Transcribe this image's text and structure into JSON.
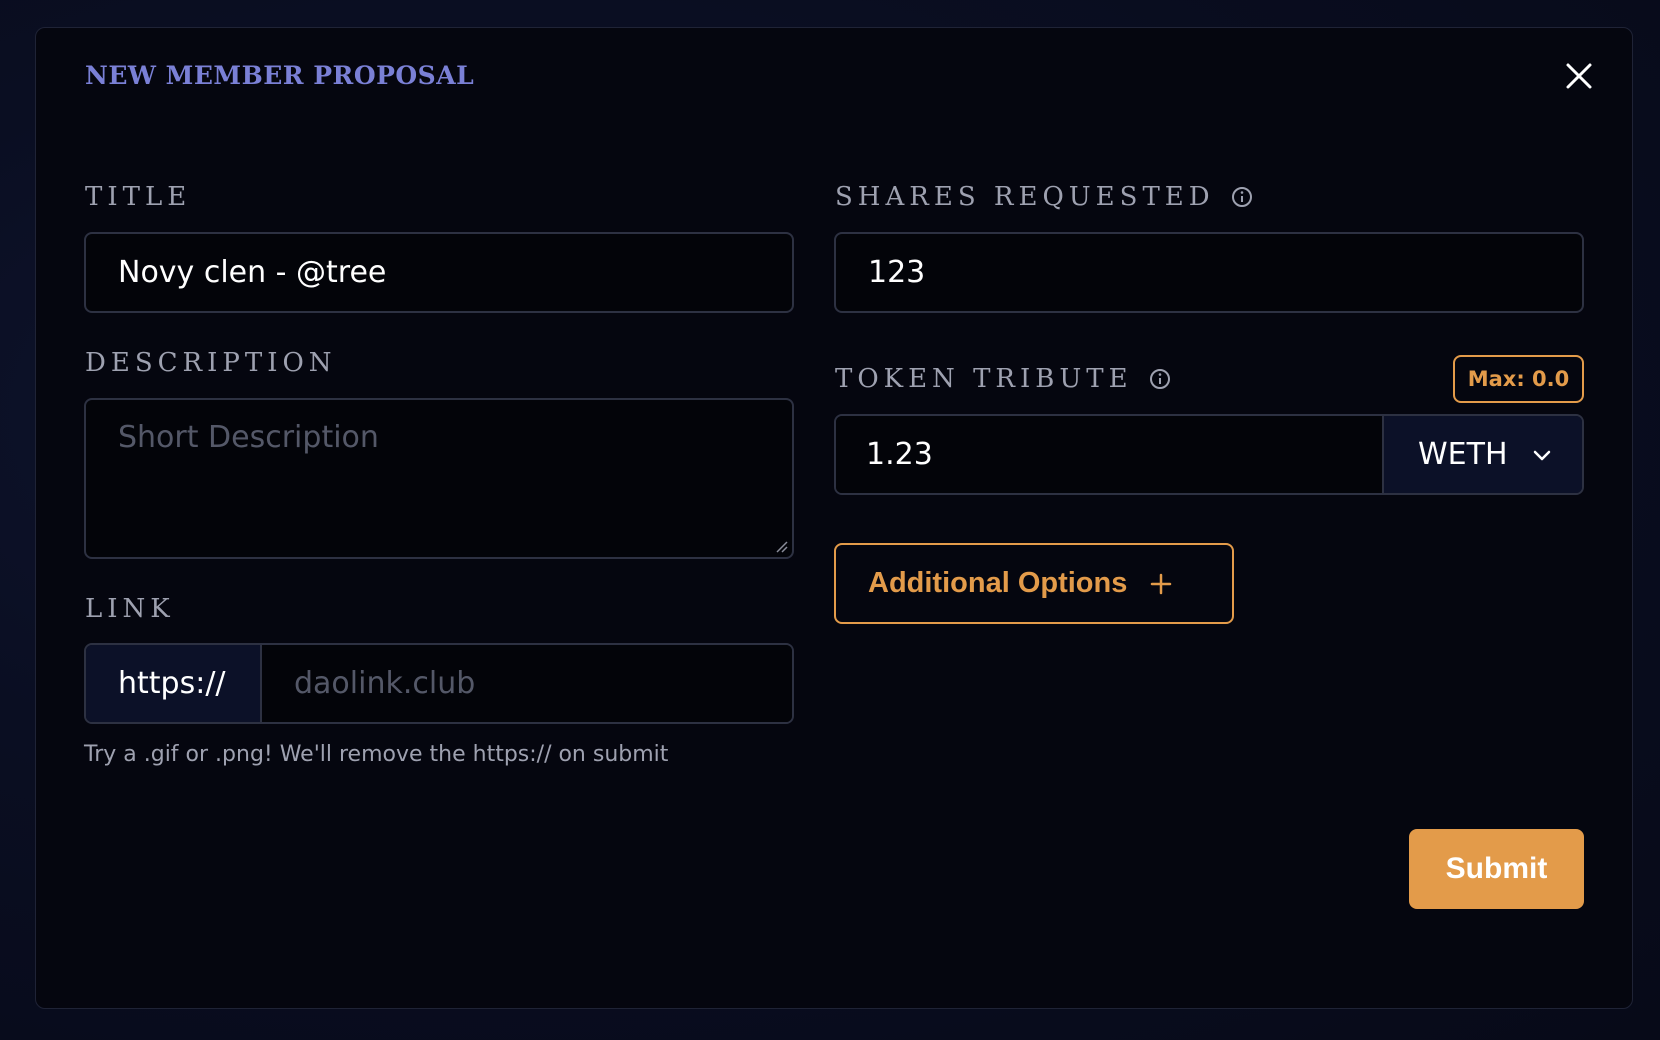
{
  "modal": {
    "title": "NEW MEMBER PROPOSAL"
  },
  "fields": {
    "title": {
      "label": "TITLE",
      "value": "Novy clen - @tree"
    },
    "description": {
      "label": "DESCRIPTION",
      "placeholder": "Short Description"
    },
    "link": {
      "label": "LINK",
      "prefix": "https://",
      "placeholder": "daolink.club",
      "helper": "Try a .gif or .png! We'll remove the https:// on submit"
    },
    "shares": {
      "label": "SHARES REQUESTED",
      "value": "123"
    },
    "tribute": {
      "label": "TOKEN TRIBUTE",
      "max_label": "Max: 0.0",
      "value": "1.23",
      "token": "WETH"
    }
  },
  "buttons": {
    "additional_options": "Additional Options",
    "submit": "Submit"
  },
  "icons": {
    "close": "close-icon",
    "info": "info-icon",
    "chevron": "chevron-down-icon",
    "plus": "plus-icon",
    "resize": "resize-grip-icon"
  },
  "colors": {
    "title": "#7a80d6",
    "accent": "#e39b4a",
    "label": "#9ea1b0",
    "field_border": "#2d3142",
    "select_bg": "#0c1128",
    "modal_bg": "#05060f"
  }
}
